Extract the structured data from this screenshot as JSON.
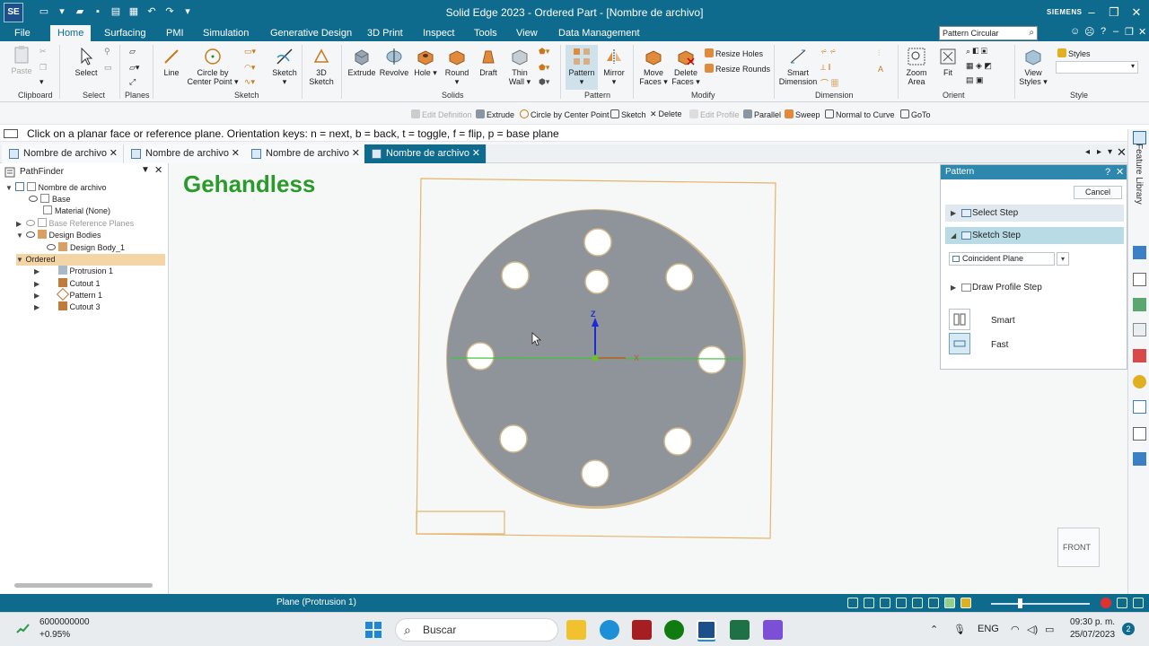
{
  "titlebar": {
    "logo": "SE",
    "title": "Solid Edge 2023 - Ordered Part - [Nombre de archivo]",
    "brand": "SIEMENS"
  },
  "menu": {
    "file": "File",
    "tabs": [
      "Home",
      "Surfacing",
      "PMI",
      "Simulation",
      "Generative Design",
      "3D Print",
      "Inspect",
      "Tools",
      "View",
      "Data Management"
    ],
    "search_value": "Pattern Circular"
  },
  "ribbon": {
    "paste": "Paste",
    "clipboard": "Clipboard",
    "select": "Select",
    "select_group": "Select",
    "planes": "Planes",
    "line": "Line",
    "circle_line1": "Circle by",
    "circle_line2": "Center Point",
    "sketch_group": "Sketch",
    "sketch": "Sketch",
    "sketch3d_line1": "3D",
    "sketch3d_line2": "Sketch",
    "extrude": "Extrude",
    "revolve": "Revolve",
    "hole": "Hole",
    "round": "Round",
    "draft": "Draft",
    "thin_line1": "Thin",
    "thin_line2": "Wall",
    "solids": "Solids",
    "pattern": "Pattern",
    "mirror": "Mirror",
    "pattern_group": "Pattern",
    "move_line1": "Move",
    "move_line2": "Faces",
    "delete_line1": "Delete",
    "delete_line2": "Faces",
    "resize_holes": "Resize Holes",
    "resize_rounds": "Resize Rounds",
    "modify": "Modify",
    "smart_line1": "Smart",
    "smart_line2": "Dimension",
    "dimension": "Dimension",
    "zoom_line1": "Zoom",
    "zoom_line2": "Area",
    "fit": "Fit",
    "orient": "Orient",
    "view_line1": "View",
    "view_line2": "Styles",
    "styles": "Styles",
    "style_group": "Style"
  },
  "commandbar": {
    "items": [
      "Edit Definition",
      "Extrude",
      "Circle by Center Point",
      "Sketch",
      "Delete",
      "Edit Profile",
      "Parallel",
      "Sweep",
      "Normal to Curve",
      "GoTo"
    ]
  },
  "prompt": "Click on a planar face or reference plane.  Orientation keys:  n = next, b = back, t = toggle, f = flip, p = base plane",
  "doctabs": [
    "Nombre de archivo",
    "Nombre de archivo",
    "Nombre de archivo",
    "Nombre de archivo"
  ],
  "pathfinder": {
    "title": "PathFinder",
    "rows": [
      {
        "label": "Nombre de archivo"
      },
      {
        "label": "Base"
      },
      {
        "label": "Material (None)"
      },
      {
        "label": "Base Reference Planes"
      },
      {
        "label": "Design Bodies"
      },
      {
        "label": "Design Body_1"
      },
      {
        "label": "Ordered"
      },
      {
        "label": "Protrusion 1"
      },
      {
        "label": "Cutout 1"
      },
      {
        "label": "Pattern 1"
      },
      {
        "label": "Cutout 3"
      }
    ]
  },
  "viewport": {
    "watermark": "Gehandless",
    "axis_z": "Z",
    "axis_x": "X",
    "viewcube": "FRONT"
  },
  "pattern_panel": {
    "title": "Pattern",
    "cancel": "Cancel",
    "steps": [
      "Select Step",
      "Sketch Step",
      "Draw Profile Step"
    ],
    "plane_option": "Coincident Plane",
    "smart": "Smart",
    "fast": "Fast"
  },
  "right_dock": {
    "feature_library": "Feature Library"
  },
  "statusbar": {
    "text": "Plane (Protrusion 1)"
  },
  "taskbar": {
    "stock_value": "6000000000",
    "stock_change": "+0.95%",
    "search": "Buscar",
    "lang": "ENG",
    "time": "09:30 p. m.",
    "date": "25/07/2023",
    "notifications": "2"
  }
}
